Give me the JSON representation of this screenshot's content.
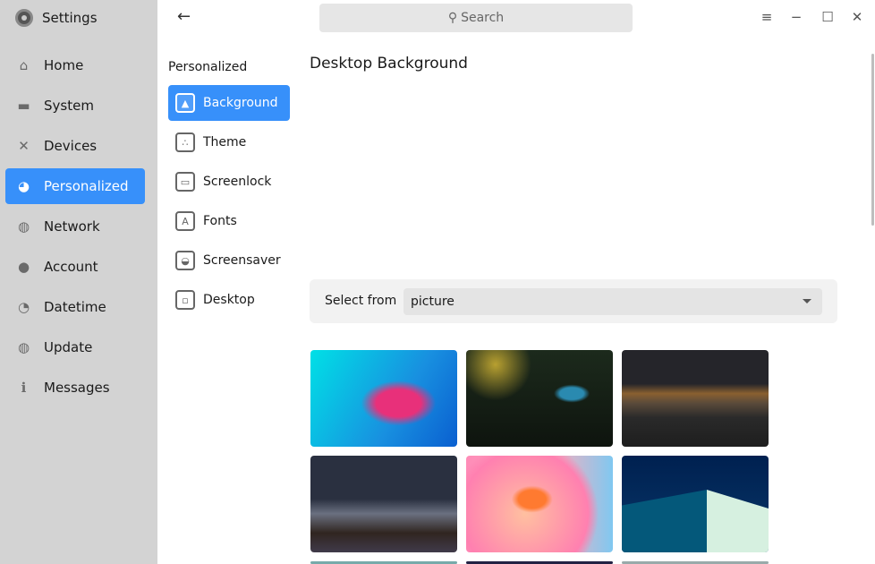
{
  "app": {
    "title": "Settings"
  },
  "sidebar": {
    "items": [
      {
        "label": "Home",
        "icon": "home-icon",
        "glyph": "⌂"
      },
      {
        "label": "System",
        "icon": "monitor-icon",
        "glyph": "▬"
      },
      {
        "label": "Devices",
        "icon": "tools-icon",
        "glyph": "✕"
      },
      {
        "label": "Personalized",
        "icon": "palette-icon",
        "glyph": "◕",
        "active": true
      },
      {
        "label": "Network",
        "icon": "globe-icon",
        "glyph": "◍"
      },
      {
        "label": "Account",
        "icon": "user-icon",
        "glyph": "●"
      },
      {
        "label": "Datetime",
        "icon": "clock-icon",
        "glyph": "◔"
      },
      {
        "label": "Update",
        "icon": "update-icon",
        "glyph": "◍"
      },
      {
        "label": "Messages",
        "icon": "info-icon",
        "glyph": "ℹ"
      }
    ]
  },
  "search": {
    "placeholder": "Search"
  },
  "subnav": {
    "heading": "Personalized",
    "items": [
      {
        "label": "Background",
        "icon": "image-icon",
        "glyph": "▲",
        "active": true
      },
      {
        "label": "Theme",
        "icon": "palette-icon",
        "glyph": "∴"
      },
      {
        "label": "Screenlock",
        "icon": "screenlock-icon",
        "glyph": "▭"
      },
      {
        "label": "Fonts",
        "icon": "fonts-icon",
        "glyph": "A"
      },
      {
        "label": "Screensaver",
        "icon": "screensaver-icon",
        "glyph": "◒"
      },
      {
        "label": "Desktop",
        "icon": "desktop-icon",
        "glyph": "▫"
      }
    ]
  },
  "main": {
    "title": "Desktop Background",
    "select_label": "Select from",
    "select_value": "picture"
  },
  "accent": "#3790fa"
}
